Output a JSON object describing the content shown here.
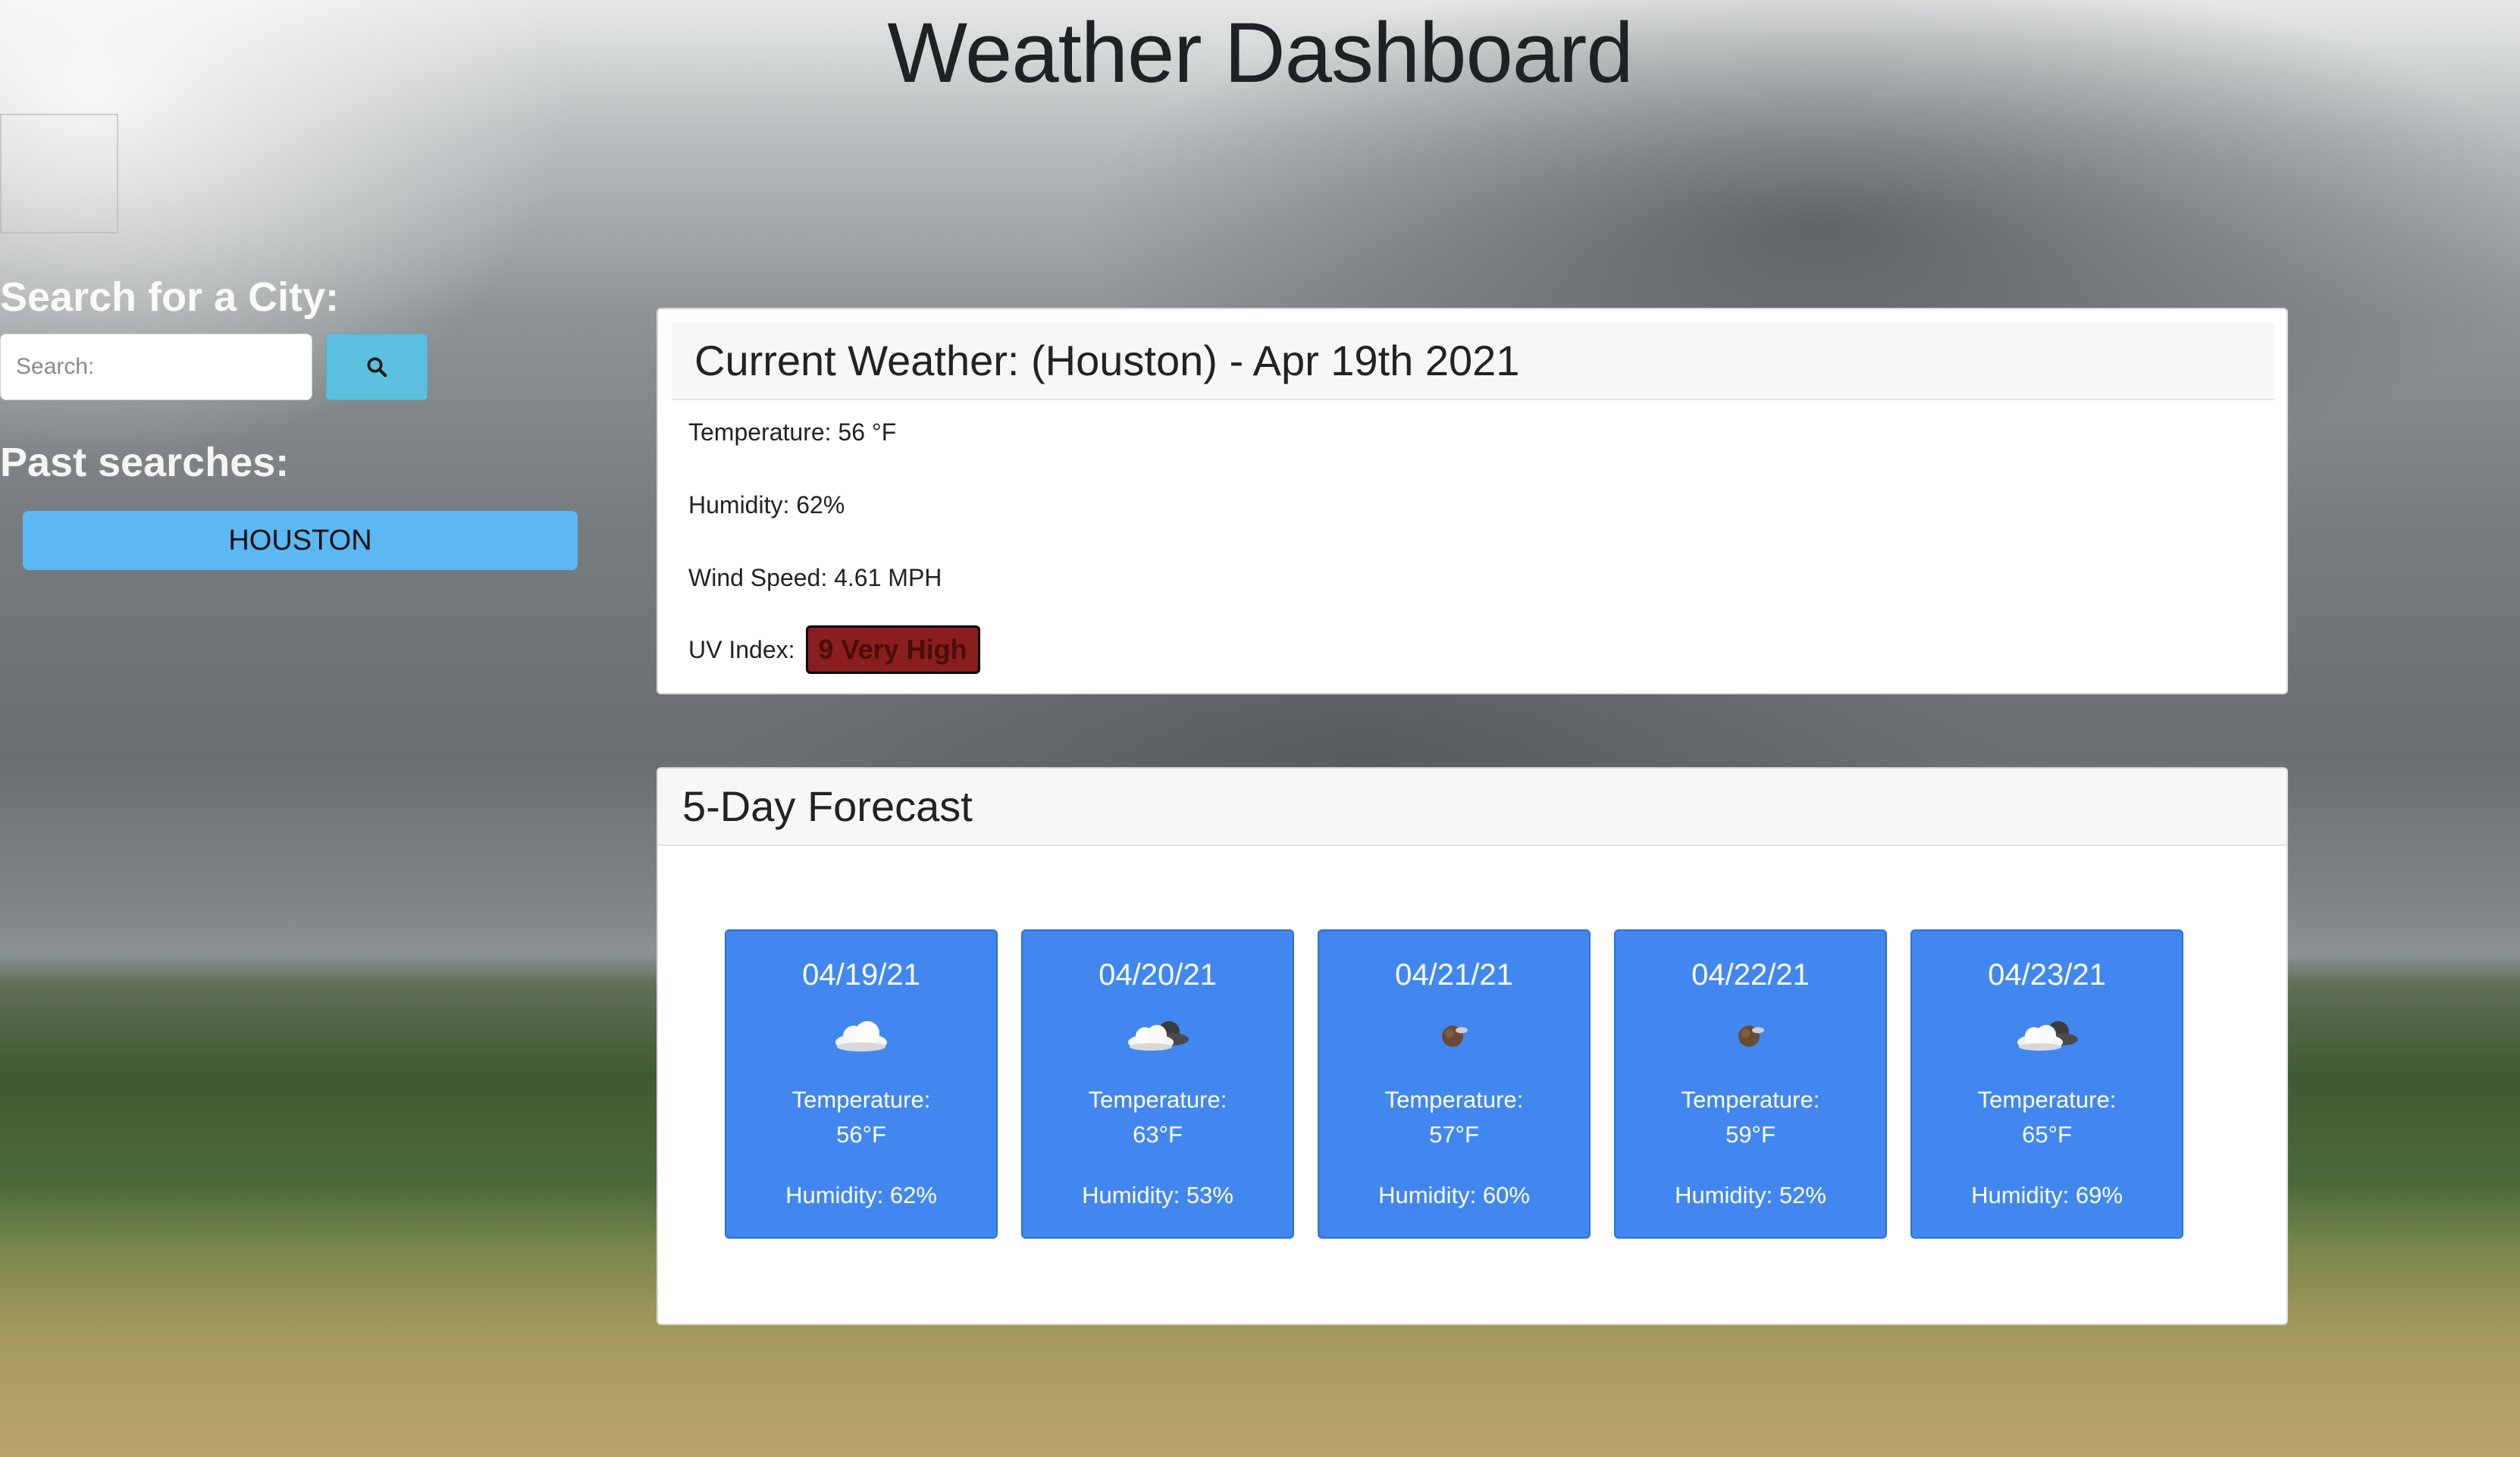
{
  "header": {
    "title": "Weather Dashboard"
  },
  "sidebar": {
    "search_heading": "Search for a City:",
    "search_placeholder": "Search:",
    "search_value": "",
    "search_icon": "search-icon",
    "past_heading": "Past searches:",
    "history": [
      {
        "label": "HOUSTON"
      }
    ]
  },
  "current": {
    "title": "Current Weather: (Houston) - Apr 19th 2021",
    "temperature": "Temperature: 56 °F",
    "humidity": "Humidity: 62%",
    "wind": "Wind Speed: 4.61 MPH",
    "uv_label": "UV Index:",
    "uv_value": "9 Very High",
    "uv_color": "#8a1d1d"
  },
  "forecast": {
    "title": "5-Day Forecast",
    "days": [
      {
        "date": "04/19/21",
        "icon": "cloud-icon",
        "temp_label": "Temperature:",
        "temp": "56°F",
        "humidity": "Humidity: 62%"
      },
      {
        "date": "04/20/21",
        "icon": "broken-clouds-icon",
        "temp_label": "Temperature:",
        "temp": "63°F",
        "humidity": "Humidity: 53%"
      },
      {
        "date": "04/21/21",
        "icon": "few-clouds-icon",
        "temp_label": "Temperature:",
        "temp": "57°F",
        "humidity": "Humidity: 60%"
      },
      {
        "date": "04/22/21",
        "icon": "few-clouds-icon",
        "temp_label": "Temperature:",
        "temp": "59°F",
        "humidity": "Humidity: 52%"
      },
      {
        "date": "04/23/21",
        "icon": "broken-clouds-icon",
        "temp_label": "Temperature:",
        "temp": "65°F",
        "humidity": "Humidity: 69%"
      }
    ]
  },
  "colors": {
    "accent_card": "#4287f0",
    "search_button": "#5bc0de",
    "history_button": "#5cb8f2"
  }
}
